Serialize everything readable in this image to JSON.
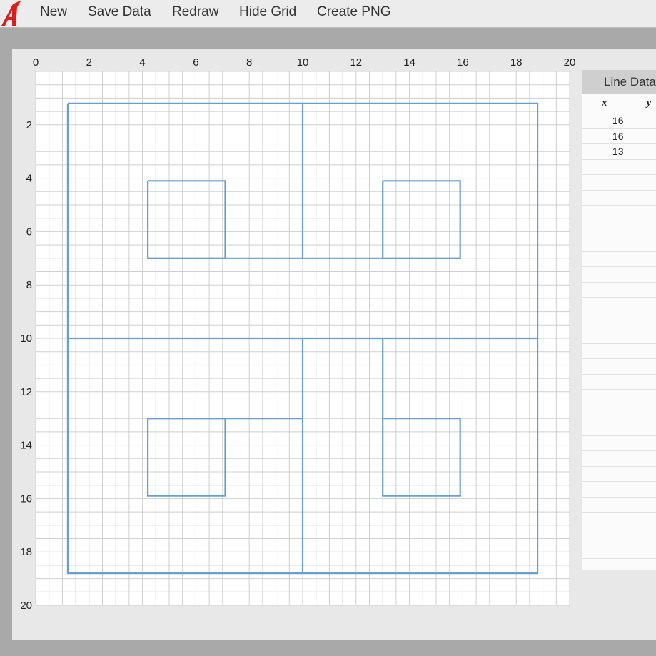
{
  "menu": {
    "logo_icon": "app-logo-icon",
    "items": [
      "New",
      "Save Data",
      "Redraw",
      "Hide Grid",
      "Create PNG"
    ]
  },
  "plot": {
    "x_ticks": [
      "0",
      "2",
      "4",
      "6",
      "8",
      "10",
      "12",
      "14",
      "16",
      "18",
      "20"
    ],
    "y_ticks": [
      "2",
      "4",
      "6",
      "8",
      "10",
      "12",
      "14",
      "16",
      "18",
      "20"
    ],
    "line_color": "#6a9fcb",
    "grid_color": "#cfcfcf"
  },
  "chart_data": {
    "type": "line",
    "xlim": [
      0,
      20
    ],
    "ylim": [
      0,
      20
    ],
    "y_inverted": true,
    "grid": true,
    "segments": [
      [
        [
          1.2,
          1.2
        ],
        [
          18.8,
          1.2
        ],
        [
          18.8,
          18.8
        ],
        [
          1.2,
          18.8
        ],
        [
          1.2,
          1.2
        ]
      ],
      [
        [
          10,
          1.2
        ],
        [
          10,
          7
        ]
      ],
      [
        [
          4.2,
          7
        ],
        [
          15.9,
          7
        ]
      ],
      [
        [
          4.2,
          4.1
        ],
        [
          7.1,
          4.1
        ],
        [
          7.1,
          7
        ],
        [
          4.2,
          7
        ],
        [
          4.2,
          4.1
        ]
      ],
      [
        [
          13,
          4.1
        ],
        [
          15.9,
          4.1
        ],
        [
          15.9,
          7
        ],
        [
          13,
          7
        ],
        [
          13,
          4.1
        ]
      ],
      [
        [
          1.2,
          10
        ],
        [
          18.8,
          10
        ]
      ],
      [
        [
          10,
          10
        ],
        [
          10,
          18.8
        ]
      ],
      [
        [
          4.2,
          13
        ],
        [
          10,
          13
        ]
      ],
      [
        [
          4.2,
          13
        ],
        [
          7.1,
          13
        ],
        [
          7.1,
          15.9
        ],
        [
          4.2,
          15.9
        ],
        [
          4.2,
          13
        ]
      ],
      [
        [
          13,
          10
        ],
        [
          13,
          15.9
        ],
        [
          15.9,
          15.9
        ],
        [
          15.9,
          13
        ],
        [
          13,
          13
        ]
      ]
    ]
  },
  "panel": {
    "title": "Line Data",
    "columns": [
      "x",
      "y"
    ],
    "rows": [
      [
        "16",
        ""
      ],
      [
        "16",
        ""
      ],
      [
        "13",
        ""
      ]
    ],
    "empty_rows": 27
  }
}
